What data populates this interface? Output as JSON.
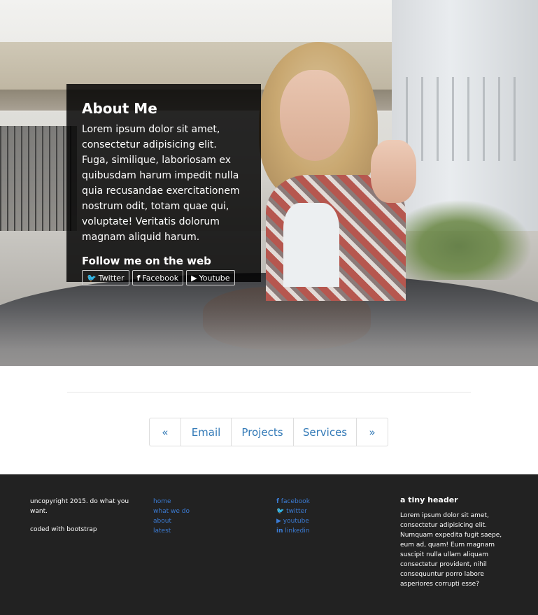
{
  "about": {
    "title": "About Me",
    "text": "Lorem ipsum dolor sit amet, consectetur adipisicing elit. Fuga, similique, laboriosam ex quibusdam harum impedit nulla quia recusandae exercitationem nostrum odit, totam quae qui, voluptate! Veritatis dolorum magnam aliquid harum.",
    "follow_label": "Follow me on the web",
    "social": [
      {
        "label": "Twitter",
        "icon": "twitter-icon",
        "glyph": "🐦"
      },
      {
        "label": "Facebook",
        "icon": "facebook-icon",
        "glyph": "f"
      },
      {
        "label": "Youtube",
        "icon": "youtube-icon",
        "glyph": "▶"
      }
    ]
  },
  "pagination": {
    "prev": "«",
    "items": [
      "Email",
      "Projects",
      "Services"
    ],
    "next": "»"
  },
  "footer": {
    "col1": {
      "line1": "uncopyright 2015. do what you want.",
      "line2": "coded with bootstrap"
    },
    "nav_links": [
      "home",
      "what we do",
      "about",
      "latest"
    ],
    "social_links": [
      {
        "label": "facebook",
        "icon": "facebook-icon",
        "glyph": "f"
      },
      {
        "label": "twitter",
        "icon": "twitter-icon",
        "glyph": "🐦"
      },
      {
        "label": "youtube",
        "icon": "youtube-icon",
        "glyph": "▶"
      },
      {
        "label": "linkedin",
        "icon": "linkedin-icon",
        "glyph": "in"
      }
    ],
    "tiny_header": "a tiny header",
    "tiny_text": "Lorem ipsum dolor sit amet, consectetur adipisicing elit. Numquam expedita fugit saepe, eum ad, quam! Eum magnam suscipit nulla ullam aliquam consectetur provident, nihil consequuntur porro labore asperiores corrupti esse?"
  },
  "colors": {
    "link": "#3b7bd3",
    "pager_link": "#337ab7",
    "footer_bg": "#222222",
    "overlay": "rgba(0,0,0,0.83)"
  }
}
